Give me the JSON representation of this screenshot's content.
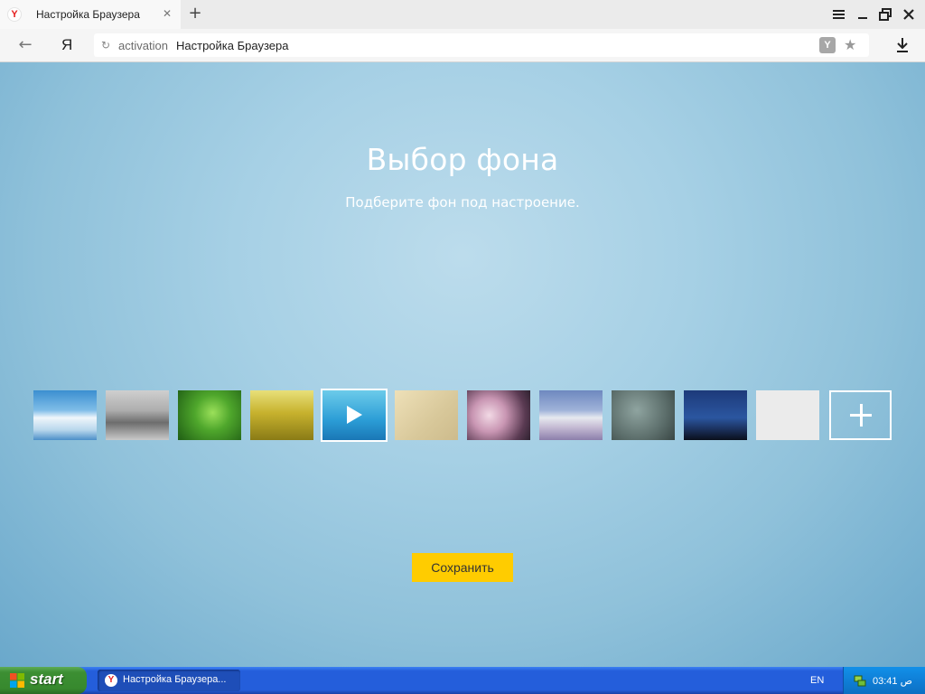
{
  "tab": {
    "title": "Настройка Браузера"
  },
  "address": {
    "host": "activation",
    "title": "Настройка Браузера"
  },
  "page": {
    "heading": "Выбор фона",
    "subtitle": "Подберите фон под настроение.",
    "save_label": "Сохранить",
    "thumbnails": [
      {
        "name": "sky-clouds"
      },
      {
        "name": "misty-forest"
      },
      {
        "name": "green-grass"
      },
      {
        "name": "golden-field"
      },
      {
        "name": "sea-video",
        "selected": true,
        "video": true
      },
      {
        "name": "sand"
      },
      {
        "name": "cherry-blossom"
      },
      {
        "name": "snowy-mountain"
      },
      {
        "name": "rain-glass"
      },
      {
        "name": "night-sky"
      },
      {
        "name": "light-gray"
      }
    ]
  },
  "taskbar": {
    "start_label": "start",
    "task_label": "Настройка Браузера...",
    "lang": "EN",
    "clock": "03:41 ص"
  }
}
